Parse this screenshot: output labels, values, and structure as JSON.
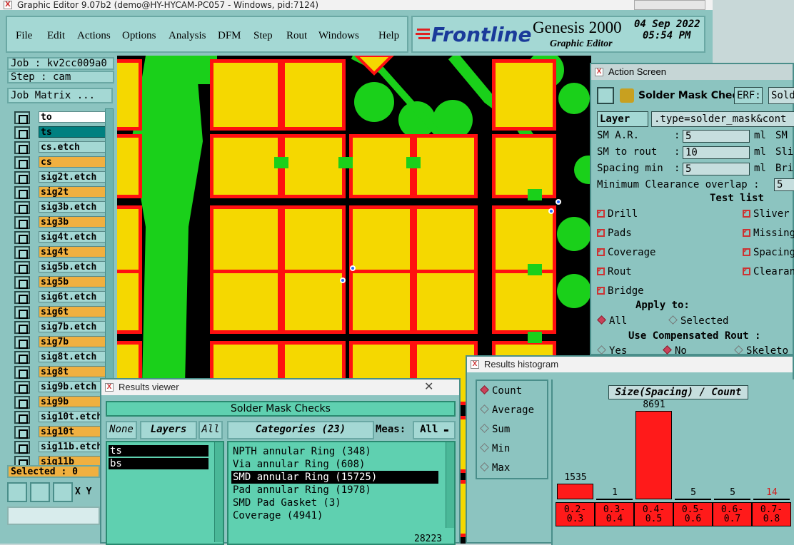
{
  "window": {
    "title": "Graphic Editor 9.07b2 (demo@HY-HYCAM-PC057 - Windows, pid:7124)"
  },
  "menu": [
    "File",
    "Edit",
    "Actions",
    "Options",
    "Analysis",
    "DFM",
    "Step",
    "Rout",
    "Windows",
    "Help"
  ],
  "brand": {
    "logo": "Frontline",
    "product": "Genesis 2000",
    "subtitle": "Graphic Editor",
    "date": "04 Sep 2022",
    "time": "05:54 PM"
  },
  "job": {
    "job_label": "Job : kv2cc009a0",
    "step_label": "Step : cam",
    "matrix_button": "Job Matrix ..."
  },
  "layers": [
    "to",
    "ts",
    "cs.etch",
    "cs",
    "sig2t.etch",
    "sig2t",
    "sig3b.etch",
    "sig3b",
    "sig4t.etch",
    "sig4t",
    "sig5b.etch",
    "sig5b",
    "sig6t.etch",
    "sig6t",
    "sig7b.etch",
    "sig7b",
    "sig8t.etch",
    "sig8t",
    "sig9b.etch",
    "sig9b",
    "sig10t.etch",
    "sig10t",
    "sig11b.etch",
    "sig11b"
  ],
  "selected_label": "Selected : 0",
  "xy_label": "X Y",
  "action_screen": {
    "title": "Action Screen",
    "header": "Solder Mask Checks",
    "erf": "ERF:",
    "erf_value": "Sold",
    "layer_label": "Layer",
    "layer_value": ".type=solder_mask&cont",
    "rows": [
      {
        "label": "SM A.R.",
        "value": "5",
        "unit": "ml",
        "right": "SM"
      },
      {
        "label": "SM to rout",
        "value": "10",
        "unit": "ml",
        "right": "Sli"
      },
      {
        "label": "Spacing min",
        "value": "5",
        "unit": "ml",
        "right": "Bri"
      }
    ],
    "min_clear_label": "Minimum Clearance overlap :",
    "min_clear_value": "5",
    "test_list": "Test list",
    "tests_left": [
      "Drill",
      "Pads",
      "Coverage",
      "Rout",
      "Bridge"
    ],
    "tests_right": [
      "Sliver",
      "Missing",
      "Spacing",
      "Clearan"
    ],
    "apply_to": "Apply to:",
    "apply_options": [
      "All",
      "Selected"
    ],
    "comp_rout": "Use Compensated Rout :",
    "comp_options": [
      "Yes",
      "No",
      "Skeleto"
    ]
  },
  "results_viewer": {
    "title": "Results viewer",
    "header": "Solder Mask Checks",
    "none_btn": "None",
    "layers_btn": "Layers",
    "all_btn": "All",
    "categories_btn": "Categories (23)",
    "meas_label": "Meas:",
    "meas_value": "All",
    "layer_items": [
      "ts",
      "bs"
    ],
    "category_items": [
      "NPTH annular Ring (348)",
      "Via annular Ring (608)",
      "SMD annular Ring (15725)",
      "Pad annular Ring (1978)",
      "SMD Pad Gasket (3)",
      "Coverage (4941)"
    ],
    "selected_category": 2,
    "bottom_value": "28223"
  },
  "histogram": {
    "title": "Results histogram",
    "options": [
      "Count",
      "Average",
      "Sum",
      "Min",
      "Max"
    ],
    "selected_option": 0,
    "chart_title": "Size(Spacing) / Count",
    "bins": [
      "0.2-0.3",
      "0.3-0.4",
      "0.4-0.5",
      "0.5-0.6",
      "0.6-0.7",
      "0.7-0.8"
    ],
    "counts": [
      1535,
      1,
      8691,
      5,
      5,
      14
    ],
    "highlight_color": "#ff1a1a",
    "last_count_color": "#d02020"
  }
}
